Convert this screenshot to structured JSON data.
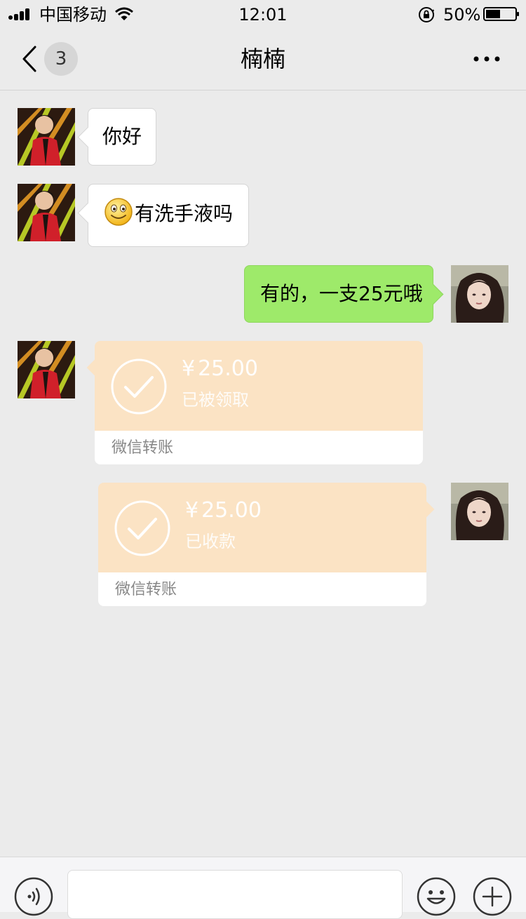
{
  "status_bar": {
    "carrier": "中国移动",
    "time": "12:01",
    "battery_percent": "50%",
    "battery_level": 0.5
  },
  "nav": {
    "unread_count": "3",
    "title": "楠楠"
  },
  "messages": [
    {
      "side": "in",
      "type": "text",
      "text": "你好"
    },
    {
      "side": "in",
      "type": "text",
      "emoji": "smile-emoji",
      "text": "有洗手液吗"
    },
    {
      "side": "out",
      "type": "text",
      "text": "有的，一支25元哦"
    },
    {
      "side": "in",
      "type": "transfer",
      "currency": "¥",
      "amount": "25.00",
      "status": "已被领取",
      "label": "微信转账"
    },
    {
      "side": "out",
      "type": "transfer",
      "currency": "¥",
      "amount": "25.00",
      "status": "已收款",
      "label": "微信转账"
    }
  ],
  "input_bar": {
    "placeholder": ""
  },
  "colors": {
    "background": "#ebebeb",
    "outgoing_bubble": "#9eea6a",
    "incoming_bubble": "#ffffff",
    "transfer": "#fbe3c4"
  }
}
